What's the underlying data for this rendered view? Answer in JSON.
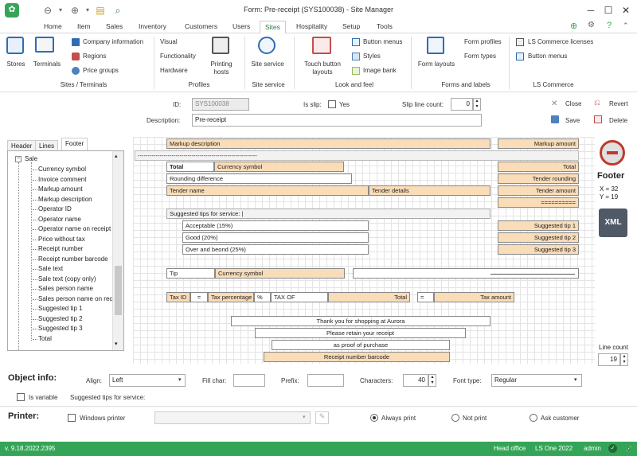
{
  "window": {
    "title": "Form: Pre-receipt (SYS100038) - Site Manager"
  },
  "menu_tabs": [
    "Home",
    "Item",
    "Sales",
    "Inventory",
    "Customers",
    "Users",
    "Sites",
    "Hospitality",
    "Setup",
    "Tools"
  ],
  "active_tab": "Sites",
  "ribbon": {
    "stores": "Stores",
    "terminals": "Terminals",
    "company_information": "Company information",
    "regions": "Regions",
    "price_groups": "Price groups",
    "group_sites_terminals": "Sites / Terminals",
    "visual": "Visual",
    "functionality": "Functionality",
    "hardware": "Hardware",
    "printing_hosts": "Printing hosts",
    "group_profiles": "Profiles",
    "site_service": "Site service",
    "group_site_service": "Site service",
    "touch_button_layouts": "Touch button layouts",
    "button_menus": "Button menus",
    "styles": "Styles",
    "image_bank": "Image bank",
    "group_look_and_feel": "Look and feel",
    "form_layouts": "Form layouts",
    "form_profiles": "Form profiles",
    "form_types": "Form types",
    "group_forms_labels": "Forms and labels",
    "ls_commerce_licenses": "LS Commerce licenses",
    "ls_button_menus": "Button menus",
    "group_ls_commerce": "LS Commerce"
  },
  "form": {
    "id_label": "ID:",
    "id_value": "SYS100038",
    "is_slip_label": "Is slip:",
    "is_slip_value": "Yes",
    "slip_line_count_label": "Slip line count:",
    "slip_line_count_value": "0",
    "description_label": "Description:",
    "description_value": "Pre-receipt",
    "close": "Close",
    "revert": "Revert",
    "save": "Save",
    "delete": "Delete"
  },
  "tree_tabs": [
    "Header",
    "Lines",
    "Footer"
  ],
  "tree_active": "Footer",
  "tree": {
    "root": "Sale",
    "items": [
      "Currency symbol",
      "Invoice comment",
      "Markup amount",
      "Markup description",
      "Operator ID",
      "Operator name",
      "Operator name on receipt",
      "Price without tax",
      "Receipt number",
      "Receipt number barcode",
      "Sale text",
      "Sale text (copy only)",
      "Sales person name",
      "Sales person name on receipt",
      "Suggested tip 1",
      "Suggested tip 2",
      "Suggested tip 3",
      "Total"
    ]
  },
  "designer": {
    "markup_description": "Markup description",
    "markup_amount": "Markup amount",
    "dashes": "------------------------------------------------------------",
    "total": "Total",
    "currency_symbol": "Currency symbol",
    "total_right": "Total",
    "rounding_difference": "Rounding difference",
    "tender_rounding": "Tender rounding",
    "tender_name": "Tender name",
    "tender_details": "Tender details",
    "tender_amount": "Tender amount",
    "equals_line": "==========",
    "suggested_tips_for_service": "Suggested tips for service: |",
    "acceptable": "Acceptable (15%)",
    "good": "Good (20%)",
    "over_and_beyond": "Over and beond (25%)",
    "suggested_tip_1": "Suggested tip 1",
    "suggested_tip_2": "Suggested tip 2",
    "suggested_tip_3": "Suggested tip 3",
    "tip": "Tip",
    "tip_currency": "Currency symbol",
    "tax_id": "Tax ID",
    "eq1": "=",
    "tax_percentage": "Tax percentage",
    "pct": "%",
    "tax_of": "TAX OF",
    "tax_total": "Total",
    "eq2": "=",
    "tax_amount": "Tax amount",
    "thank_you": "Thank you for shopping at Aurora",
    "retain": "Please retain your receipt",
    "proof": "as proof of purchase",
    "receipt_barcode": "Receipt number barcode"
  },
  "side_panel": {
    "footer_label": "Footer",
    "x": "X = 32",
    "y": "Y = 19",
    "xml": "XML",
    "line_count_label": "Line count",
    "line_count_value": "19"
  },
  "object_info": {
    "title": "Object info:",
    "align_label": "Align:",
    "align_value": "Left",
    "fill_char_label": "Fill char:",
    "prefix_label": "Prefix:",
    "characters_label": "Characters:",
    "characters_value": "40",
    "font_type_label": "Font type:",
    "font_type_value": "Regular",
    "is_variable_label": "Is variable",
    "object_text": "Suggested tips for service:"
  },
  "printer": {
    "title": "Printer:",
    "windows_printer": "Windows printer",
    "always_print": "Always print",
    "not_print": "Not print",
    "ask_customer": "Ask customer"
  },
  "status": {
    "version": "v. 9.18.2022.2395",
    "office": "Head office",
    "product": "LS One 2022",
    "user": "admin"
  },
  "colors": {
    "accent": "#34a557",
    "field_orange": "#f9dcb8",
    "tab_green": "#2b7a3e"
  }
}
